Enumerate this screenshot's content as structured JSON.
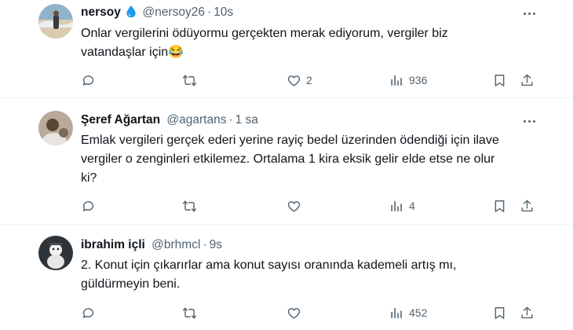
{
  "tweets": [
    {
      "name": "nersoy",
      "badge": "💧",
      "handle": "@nersoy26",
      "time": "10s",
      "text_line1": "Onlar vergilerini ödüyormu gerçekten merak ediyorum, vergiler biz",
      "text_line2": "vatandaşlar için😂",
      "likes": "2",
      "views": "936"
    },
    {
      "name": "Şeref Ağartan",
      "handle": "@agartans",
      "time": "1 sa",
      "text_line1": "Emlak vergileri gerçek ederi yerine rayiç bedel üzerinden ödendiği için ilave",
      "text_line2": "vergiler o zenginleri etkilemez. Ortalama 1 kira eksik gelir elde etse ne olur",
      "text_line3": "ki?",
      "views": "4"
    },
    {
      "name": "ibrahim içli",
      "handle": "@brhmcl",
      "time": "9s",
      "text_line1": "2. Konut için çıkarırlar ama konut sayısı oranında kademeli artış mı,",
      "text_line2": "güldürmeyin beni.",
      "views": "452"
    }
  ],
  "icons": {
    "reply": "reply-icon",
    "retweet": "retweet-icon",
    "like": "heart-icon",
    "views": "views-icon",
    "bookmark": "bookmark-icon",
    "share": "share-icon",
    "more": "more-icon",
    "badge": "water-drop-icon"
  },
  "colors": {
    "text": "#0f1419",
    "secondary": "#536471",
    "divider": "#eff3f4",
    "badge": "#1d9bf0"
  }
}
